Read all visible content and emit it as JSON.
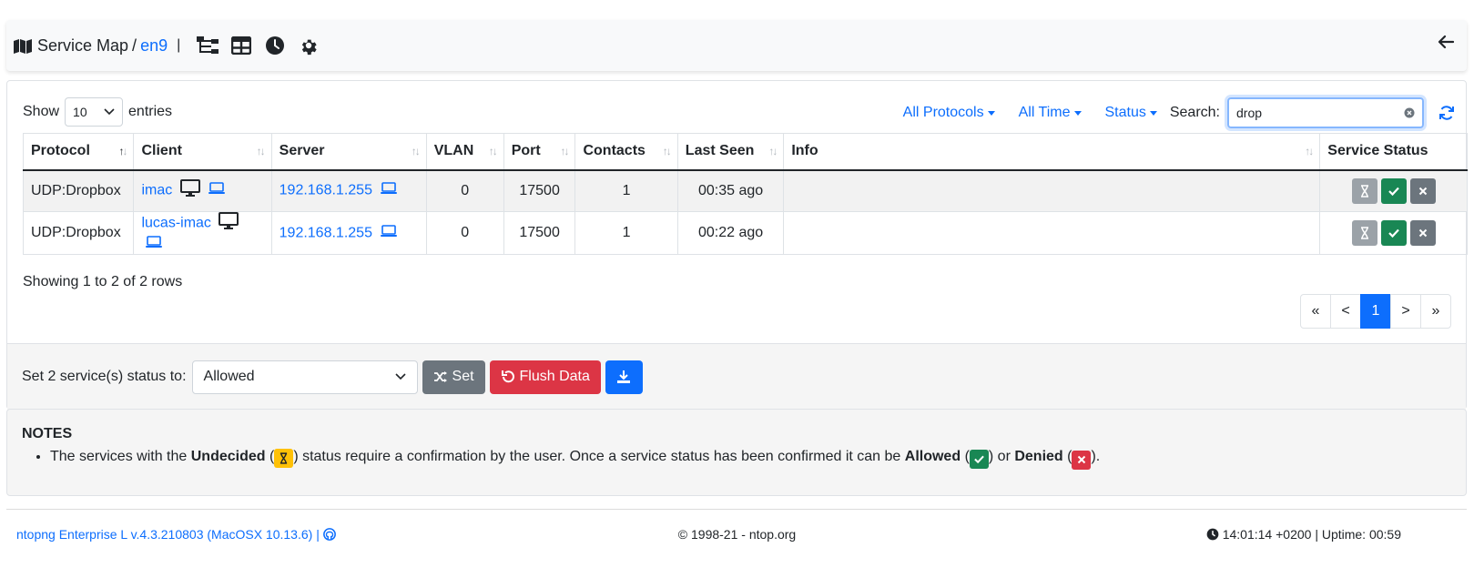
{
  "header": {
    "title": "Service Map",
    "separator": "/",
    "interface": "en9",
    "divider": "|"
  },
  "toolbar": {
    "show_label": "Show",
    "entries_value": "10",
    "entries_label": "entries",
    "filters": [
      "All Protocols",
      "All Time",
      "Status"
    ],
    "search_label": "Search:",
    "search_value": "drop"
  },
  "table": {
    "columns": [
      "Protocol",
      "Client",
      "Server",
      "VLAN",
      "Port",
      "Contacts",
      "Last Seen",
      "Info",
      "Service Status"
    ],
    "rows": [
      {
        "protocol": "UDP:Dropbox",
        "client": "imac",
        "server": "192.168.1.255",
        "vlan": "0",
        "port": "17500",
        "contacts": "1",
        "last_seen": "00:35 ago",
        "info": ""
      },
      {
        "protocol": "UDP:Dropbox",
        "client": "lucas-imac",
        "server": "192.168.1.255",
        "vlan": "0",
        "port": "17500",
        "contacts": "1",
        "last_seen": "00:22 ago",
        "info": ""
      }
    ]
  },
  "showing": "Showing 1 to 2 of 2 rows",
  "pagination": {
    "first": "«",
    "prev": "<",
    "current": "1",
    "next": ">",
    "last": "»"
  },
  "bulk": {
    "label": "Set 2 service(s) status to:",
    "selected": "Allowed",
    "set_label": "Set",
    "flush_label": "Flush Data"
  },
  "notes": {
    "title": "NOTES",
    "text_1": "The services with the ",
    "undecided": "Undecided",
    "text_2": " status require a confirmation by the user. Once a service status has been confirmed it can be ",
    "allowed": "Allowed",
    "text_3": " or ",
    "denied": "Denied",
    "text_4": ".",
    "open_paren": "(",
    "close_paren": ")"
  },
  "footer": {
    "version": "ntopng Enterprise L v.4.3.210803 (MacOSX 10.13.6) |",
    "copyright": "© 1998-21 - ntop.org",
    "time": "14:01:14 +0200 | Uptime: 00:59"
  },
  "colors": {
    "primary": "#0d6efd",
    "success": "#198754",
    "danger": "#dc3545",
    "warning": "#ffc107",
    "secondary": "#6c757d"
  }
}
